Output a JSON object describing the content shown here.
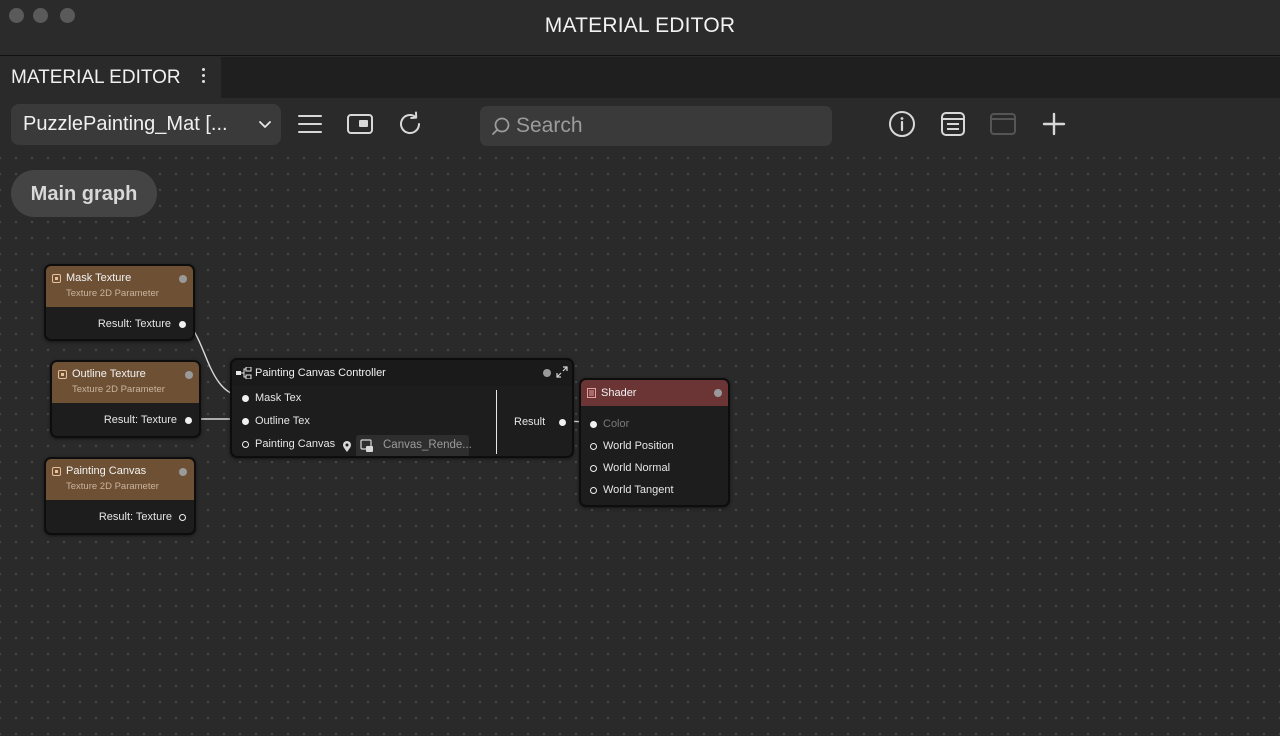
{
  "window": {
    "title": "MATERIAL EDITOR"
  },
  "panel_tab": {
    "label": "MATERIAL EDITOR"
  },
  "toolbar": {
    "material_select": "PuzzlePainting_Mat [...",
    "search_placeholder": "Search"
  },
  "graph": {
    "breadcrumb": "Main graph"
  },
  "nodes": {
    "mask_texture": {
      "title": "Mask Texture",
      "subtitle": "Texture 2D Parameter",
      "output": "Result: Texture"
    },
    "outline_texture": {
      "title": "Outline Texture",
      "subtitle": "Texture 2D Parameter",
      "output": "Result: Texture"
    },
    "painting_canvas": {
      "title": "Painting Canvas",
      "subtitle": "Texture 2D Parameter",
      "output": "Result: Texture"
    },
    "controller": {
      "title": "Painting Canvas Controller",
      "inputs": [
        "Mask Tex",
        "Outline Tex",
        "Painting Canvas"
      ],
      "canvas_value": "Canvas_Rende...",
      "output": "Result"
    },
    "shader": {
      "title": "Shader",
      "inputs": [
        "Color",
        "World Position",
        "World Normal",
        "World Tangent"
      ]
    }
  },
  "colors": {
    "texture_header": "#6e5135",
    "shader_header": "#6b3535",
    "wire": "#d8d8d8"
  }
}
